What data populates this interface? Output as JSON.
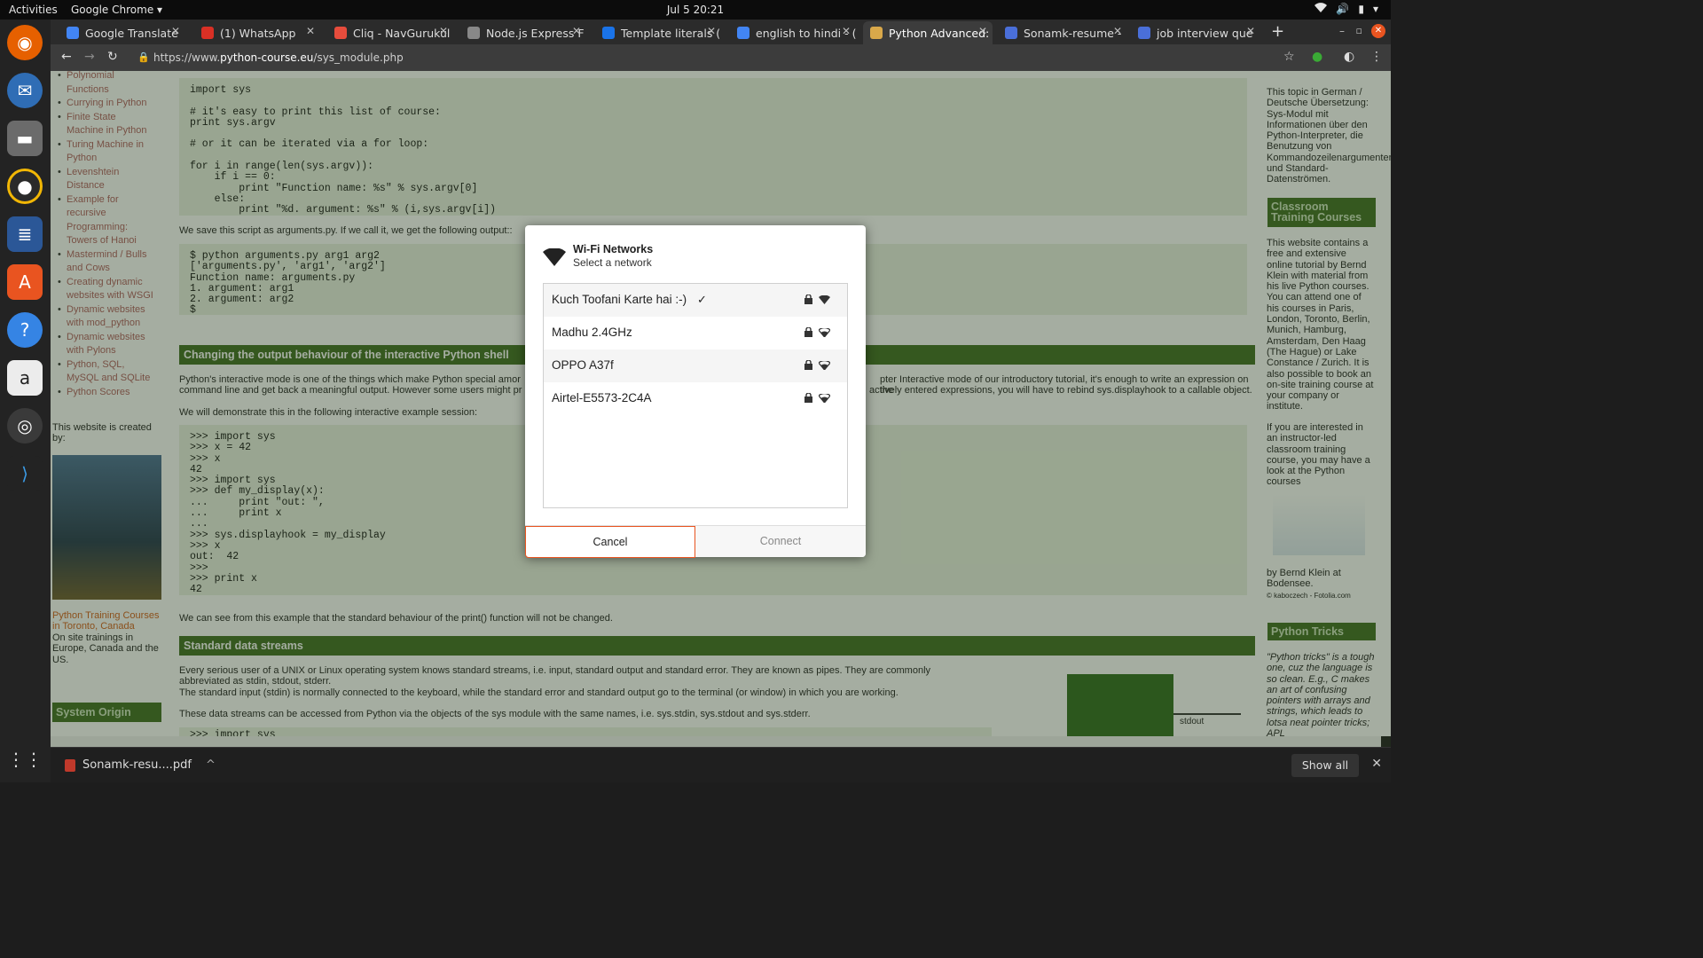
{
  "system": {
    "activities": "Activities",
    "app_menu": "Google Chrome ▾",
    "clock": "Jul 5  20:21"
  },
  "tabs": [
    {
      "label": "Google Translate",
      "color": "#4285f4"
    },
    {
      "label": "(1) WhatsApp",
      "color": "#d93025"
    },
    {
      "label": "Cliq - NavGurukul",
      "color": "#e74c3c"
    },
    {
      "label": "Node.js Express F",
      "color": "#888888"
    },
    {
      "label": "Template literals (",
      "color": "#1a73e8"
    },
    {
      "label": "english to hindi - (",
      "color": "#4285f4"
    },
    {
      "label": "Python Advanced:",
      "color": "#d9a84a"
    },
    {
      "label": "Sonamk-resume -",
      "color": "#4a6fd9"
    },
    {
      "label": "job interview que",
      "color": "#4a6fd9"
    }
  ],
  "url": {
    "prefix": "https://www.",
    "host": "python-course.eu",
    "path": "/sys_module.php"
  },
  "left_nav": [
    "Polynomial Functions",
    "Currying in Python",
    "Finite State Machine in Python",
    "Turing Machine in Python",
    "Levenshtein Distance",
    "Example for recursive Programming: Towers of Hanoi",
    "Mastermind / Bulls and Cows",
    "Creating dynamic websites with WSGI",
    "Dynamic websites with mod_python",
    "Dynamic websites with Pylons",
    "Python, SQL, MySQL and SQLite",
    "Python Scores"
  ],
  "left_extra": {
    "created_by": "This website is created by:",
    "courses_link": "Python Training Courses in Toronto, Canada",
    "onsite": "On site trainings in Europe, Canada and the US.",
    "system_origin": "System Origin"
  },
  "main": {
    "code1": "import sys\n\n# it's easy to print this list of course:\nprint sys.argv\n\n# or it can be iterated via a for loop:\n\nfor i in range(len(sys.argv)):\n    if i == 0:\n        print \"Function name: %s\" % sys.argv[0]\n    else:\n        print \"%d. argument: %s\" % (i,sys.argv[i])",
    "save_text": "We save this script as arguments.py. If we call it, we get the following output::",
    "code2": "$ python arguments.py arg1 arg2\n['arguments.py', 'arg1', 'arg2']\nFunction name: arguments.py\n1. argument: arg1\n2. argument: arg2\n$",
    "heading1": "Changing the output behaviour of the interactive Python shell",
    "para1a": "Python's interactive mode is one of the things which make Python special amor",
    "para1b": "pter Interactive mode of our introductory tutorial, it's enough to write an expression on the",
    "para1c": "command line and get back a meaningful output. However some users might pr",
    "para1d": "actively entered expressions, you will have to rebind sys.displayhook to a callable object.",
    "demo_text": "We will demonstrate this in the following interactive example session:",
    "code3": ">>> import sys\n>>> x = 42\n>>> x\n42\n>>> import sys\n>>> def my_display(x):\n...     print \"out: \",\n...     print x\n...\n>>> sys.displayhook = my_display\n>>> x\nout:  42\n>>>\n>>> print x\n42",
    "print_text": "We can see from this example that the standard behaviour of the print() function will not be changed.",
    "heading2": "Standard data streams",
    "para2a": "Every serious user of a UNIX or Linux operating system knows standard streams, i.e. input, standard output and standard error. They are known as pipes. They are commonly",
    "para2b": "abbreviated as stdin, stdout, stderr.",
    "para2c": "The standard input (stdin) is normally connected to the keyboard, while the standard error and standard output go to the terminal (or window) in which you are working.",
    "para2d": "These data streams can be accessed from Python via the objects of the sys module with the same names, i.e. sys.stdin, sys.stdout and sys.stderr.",
    "code4": ">>> import sys",
    "stdout_label": "stdout"
  },
  "right": {
    "german": "This topic in German / Deutsche Übersetzung: Sys-Modul mit Informationen über den Python-Interpreter, die Benutzung von Kommandozeilenargumenten und Standard-Datenströmen.",
    "classroom_head": "Classroom Training Courses",
    "classroom_text": "This website contains a free and extensive online tutorial by Bernd Klein with material from his live Python courses. You can attend one of his courses in Paris, London, Toronto, Berlin, Munich, Hamburg, Amsterdam, Den Haag (The Hague) or Lake Constance / Zurich. It is also possible to book an on-site training course at your company or institute.",
    "instructor_text": "If you are interested in an instructor-led classroom training course, you may have a look at the Python courses",
    "caption": "by Bernd Klein at Bodensee.",
    "credit": "© kaboczech - Fotolia.com",
    "tricks_head": "Python Tricks",
    "tricks_text": "\"Python tricks\" is a tough one, cuz the language is so clean. E.g., C makes an art of confusing pointers with arrays and strings, which leads to lotsa neat pointer tricks; APL"
  },
  "dialog": {
    "title": "Wi-Fi Networks",
    "subtitle": "Select a network",
    "networks": [
      {
        "ssid": "Kuch Toofani Karte hai :-)",
        "connected": true
      },
      {
        "ssid": "Madhu 2.4GHz",
        "connected": false
      },
      {
        "ssid": "OPPO A37f",
        "connected": false
      },
      {
        "ssid": "Airtel-E5573-2C4A",
        "connected": false
      }
    ],
    "cancel": "Cancel",
    "connect": "Connect",
    "accent": "#e95420"
  },
  "downloads": {
    "file": "Sonamk-resu....pdf",
    "show_all": "Show all"
  }
}
